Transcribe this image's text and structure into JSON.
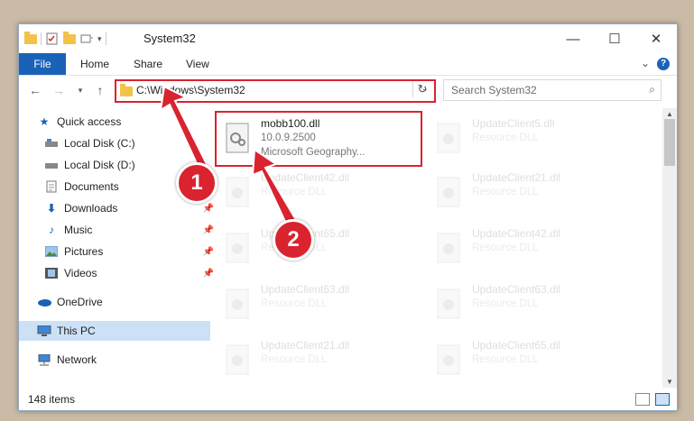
{
  "window": {
    "title": "System32"
  },
  "ribbon": {
    "tabs": [
      "File",
      "Home",
      "Share",
      "View"
    ]
  },
  "navigation": {
    "address": "C:\\Windows\\System32",
    "search_placeholder": "Search System32"
  },
  "sidebar": {
    "items": [
      {
        "label": "Quick access",
        "icon": "star-icon",
        "pinned": false
      },
      {
        "label": "Local Disk (C:)",
        "icon": "drive-icon",
        "pinned": false
      },
      {
        "label": "Local Disk (D:)",
        "icon": "drive-icon",
        "pinned": false
      },
      {
        "label": "Documents",
        "icon": "document-icon",
        "pinned": false
      },
      {
        "label": "Downloads",
        "icon": "download-icon",
        "pinned": true
      },
      {
        "label": "Music",
        "icon": "music-icon",
        "pinned": true
      },
      {
        "label": "Pictures",
        "icon": "pictures-icon",
        "pinned": true
      },
      {
        "label": "Videos",
        "icon": "video-icon",
        "pinned": true
      },
      {
        "label": "OneDrive",
        "icon": "cloud-icon",
        "pinned": false
      },
      {
        "label": "This PC",
        "icon": "computer-icon",
        "pinned": false,
        "selected": true
      },
      {
        "label": "Network",
        "icon": "network-icon",
        "pinned": false
      }
    ]
  },
  "files": {
    "highlighted": {
      "name": "mobb100.dll",
      "version": "10.0.9.2500",
      "description": "Microsoft Geography..."
    },
    "faded": [
      {
        "name": "UpdateClient5.dll",
        "type": "Resource DLL"
      },
      {
        "name": "UpdateClient42.dll",
        "type": "Resource DLL"
      },
      {
        "name": "UpdateClient21.dll",
        "type": "Resource DLL"
      },
      {
        "name": "UpdateClient65.dll",
        "type": "Resource DLL"
      },
      {
        "name": "UpdateClient42.dll",
        "type": "Resource DLL"
      },
      {
        "name": "UpdateClient63.dll",
        "type": "Resource DLL"
      },
      {
        "name": "UpdateClient63.dll",
        "type": "Resource DLL"
      },
      {
        "name": "UpdateClient21.dll",
        "type": "Resource DLL"
      },
      {
        "name": "UpdateClient65.dll",
        "type": "Resource DLL"
      }
    ]
  },
  "status": {
    "item_count": "148 items"
  },
  "annotations": {
    "step1": "1",
    "step2": "2"
  },
  "colors": {
    "accent": "#1a62b8",
    "annotation_red": "#d9232f"
  }
}
